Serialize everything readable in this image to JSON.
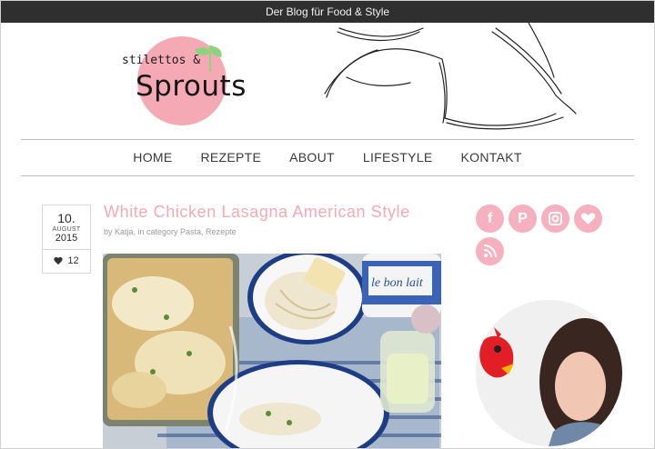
{
  "topbar": {
    "tagline": "Der Blog für Food & Style"
  },
  "logo": {
    "top": "stilettos &",
    "main": "Sprouts"
  },
  "nav": {
    "items": [
      "HOME",
      "REZEPTE",
      "ABOUT",
      "LIFESTYLE",
      "KONTAKT"
    ]
  },
  "post": {
    "date": {
      "day": "10.",
      "month": "AUGUST",
      "year": "2015"
    },
    "likes": "12",
    "title": "White Chicken Lasagna American Style",
    "meta": "by Katja, in category Pasta, Rezepte"
  },
  "social": {
    "icons": [
      "facebook-icon",
      "pinterest-icon",
      "instagram-icon",
      "heart-icon",
      "rss-icon"
    ]
  },
  "image": {
    "label_jar": "le bon lait"
  },
  "colors": {
    "accent": "#f4a9b5",
    "topbar": "#2f2f2f",
    "navtext": "#3a3a3a",
    "meta": "#9b9b9b"
  }
}
